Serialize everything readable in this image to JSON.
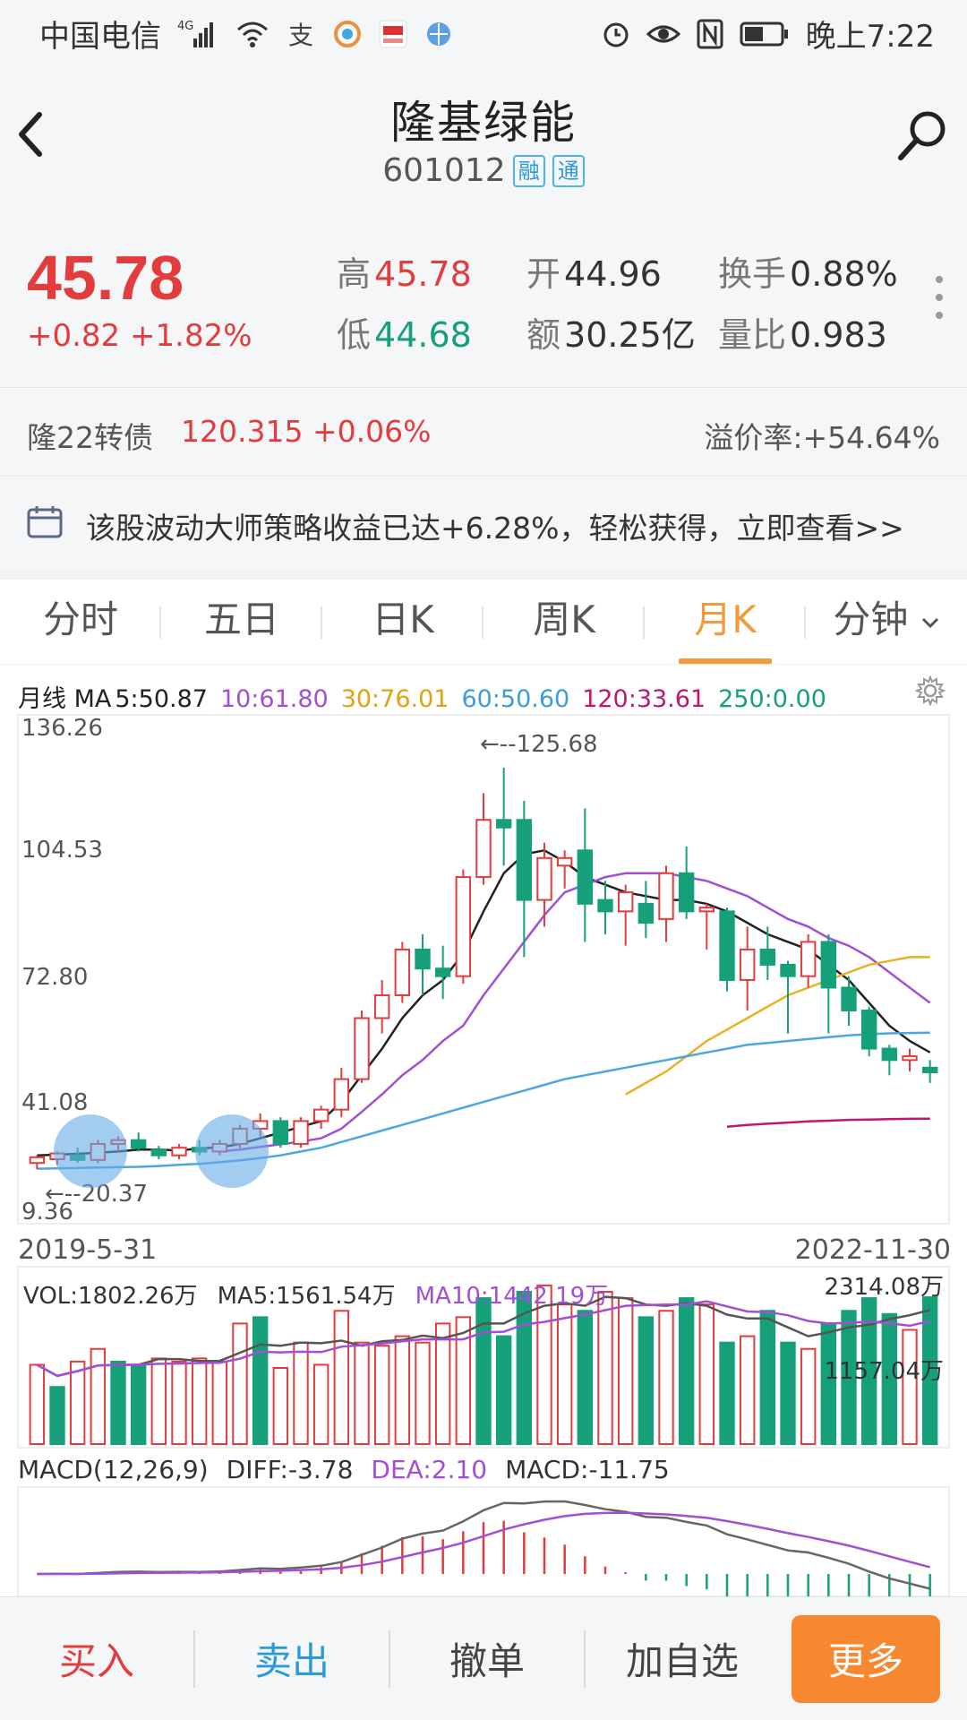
{
  "status_bar": {
    "carrier": "中国电信",
    "network": "4G",
    "time": "晚上7:22",
    "icons": [
      "signal-icon",
      "wifi-icon",
      "app-icon-1",
      "app-icon-2",
      "app-icon-3",
      "app-icon-4",
      "alarm-icon",
      "eye-icon",
      "nfc-icon",
      "battery-icon"
    ]
  },
  "header": {
    "name": "隆基绿能",
    "code": "601012",
    "tags": [
      "融",
      "通"
    ]
  },
  "quote": {
    "price": "45.78",
    "change": "+0.82",
    "change_pct": "+1.82%",
    "high_label": "高",
    "high": "45.78",
    "low_label": "低",
    "low": "44.68",
    "open_label": "开",
    "open": "44.96",
    "amount_label": "额",
    "amount": "30.25亿",
    "turnover_label": "换手",
    "turnover": "0.88%",
    "volume_ratio_label": "量比",
    "volume_ratio": "0.983"
  },
  "convertible_bond": {
    "label": "隆22转债",
    "value": "120.315 +0.06%",
    "premium": "溢价率:+54.64%"
  },
  "promo": {
    "text": "该股波动大师策略收益已达+6.28%，轻松获得，立即查看>>"
  },
  "tabs": [
    {
      "label": "分时",
      "active": false
    },
    {
      "label": "五日",
      "active": false
    },
    {
      "label": "日K",
      "active": false
    },
    {
      "label": "周K",
      "active": false
    },
    {
      "label": "月K",
      "active": true
    },
    {
      "label": "分钟",
      "active": false
    }
  ],
  "ma_legend": {
    "prefix": "月线 MA",
    "ma5": "5:50.87",
    "ma10": "10:61.80",
    "ma30": "30:76.01",
    "ma60": "60:50.60",
    "ma120": "120:33.61",
    "ma250": "250:0.00"
  },
  "colors": {
    "up": "#e23c3c",
    "down": "#16a07a",
    "ma5": "#222222",
    "ma10": "#a24fd6",
    "ma30": "#eab021",
    "ma60": "#4ea6df",
    "ma120": "#c0166f",
    "ma250": "#16a07a",
    "accent": "#f39a3a"
  },
  "chart_data": [
    {
      "type": "candlestick",
      "title": "",
      "y_ticks": [
        "136.26",
        "104.53",
        "72.80",
        "41.08",
        "9.36"
      ],
      "ylim": [
        9.36,
        136.26
      ],
      "x_start": "2019-5-31",
      "x_end": "2022-11-30",
      "max_marker": "125.68",
      "min_marker": "20.37",
      "candles": [
        {
          "o": 22,
          "h": 24,
          "l": 20.4,
          "c": 23.5,
          "up": true
        },
        {
          "o": 23,
          "h": 25,
          "l": 21.5,
          "c": 24.5,
          "up": true
        },
        {
          "o": 24,
          "h": 26,
          "l": 22,
          "c": 22.8,
          "up": false
        },
        {
          "o": 22.8,
          "h": 28,
          "l": 22,
          "c": 27,
          "up": true
        },
        {
          "o": 27,
          "h": 29,
          "l": 25,
          "c": 28,
          "up": true
        },
        {
          "o": 28,
          "h": 30,
          "l": 25,
          "c": 26,
          "up": false
        },
        {
          "o": 25.5,
          "h": 26.5,
          "l": 23,
          "c": 24,
          "up": false
        },
        {
          "o": 24,
          "h": 27,
          "l": 23,
          "c": 26,
          "up": true
        },
        {
          "o": 26,
          "h": 28,
          "l": 24,
          "c": 25,
          "up": false
        },
        {
          "o": 25,
          "h": 28,
          "l": 24,
          "c": 27,
          "up": true
        },
        {
          "o": 27,
          "h": 32,
          "l": 26,
          "c": 31,
          "up": true
        },
        {
          "o": 31,
          "h": 35,
          "l": 29,
          "c": 33,
          "up": true
        },
        {
          "o": 33,
          "h": 34,
          "l": 26,
          "c": 27,
          "up": false
        },
        {
          "o": 27,
          "h": 34,
          "l": 26,
          "c": 33,
          "up": true
        },
        {
          "o": 33,
          "h": 37,
          "l": 31,
          "c": 36,
          "up": true
        },
        {
          "o": 36,
          "h": 47,
          "l": 34,
          "c": 44,
          "up": true
        },
        {
          "o": 44,
          "h": 62,
          "l": 43,
          "c": 60,
          "up": true
        },
        {
          "o": 60,
          "h": 70,
          "l": 56,
          "c": 66,
          "up": true
        },
        {
          "o": 66,
          "h": 80,
          "l": 64,
          "c": 78,
          "up": true
        },
        {
          "o": 78,
          "h": 82,
          "l": 66,
          "c": 73,
          "up": false
        },
        {
          "o": 73,
          "h": 79,
          "l": 65,
          "c": 71,
          "up": false
        },
        {
          "o": 71,
          "h": 99,
          "l": 69,
          "c": 97,
          "up": true
        },
        {
          "o": 97,
          "h": 119,
          "l": 95,
          "c": 112,
          "up": true
        },
        {
          "o": 112,
          "h": 125.68,
          "l": 100,
          "c": 110,
          "up": false
        },
        {
          "o": 112,
          "h": 117,
          "l": 76,
          "c": 91,
          "up": false
        },
        {
          "o": 91,
          "h": 106,
          "l": 84,
          "c": 102,
          "up": true
        },
        {
          "o": 102,
          "h": 104,
          "l": 94,
          "c": 100,
          "up": true
        },
        {
          "o": 104,
          "h": 115,
          "l": 80,
          "c": 90,
          "up": false
        },
        {
          "o": 91,
          "h": 96,
          "l": 82,
          "c": 88,
          "up": false
        },
        {
          "o": 88,
          "h": 95,
          "l": 79,
          "c": 93,
          "up": true
        },
        {
          "o": 90,
          "h": 96,
          "l": 81,
          "c": 85,
          "up": false
        },
        {
          "o": 86,
          "h": 100,
          "l": 80,
          "c": 98,
          "up": true
        },
        {
          "o": 98,
          "h": 105,
          "l": 86,
          "c": 88,
          "up": false
        },
        {
          "o": 88,
          "h": 90,
          "l": 78,
          "c": 89,
          "up": true
        },
        {
          "o": 88,
          "h": 89,
          "l": 67,
          "c": 70,
          "up": false
        },
        {
          "o": 70,
          "h": 84,
          "l": 62,
          "c": 78,
          "up": true
        },
        {
          "o": 78,
          "h": 84,
          "l": 70,
          "c": 74,
          "up": false
        },
        {
          "o": 74,
          "h": 75,
          "l": 56,
          "c": 71,
          "up": false
        },
        {
          "o": 71,
          "h": 82,
          "l": 68,
          "c": 80,
          "up": true
        },
        {
          "o": 80,
          "h": 82,
          "l": 56,
          "c": 68,
          "up": false
        },
        {
          "o": 68,
          "h": 71,
          "l": 58,
          "c": 62,
          "up": false
        },
        {
          "o": 62,
          "h": 63,
          "l": 50,
          "c": 52,
          "up": false
        },
        {
          "o": 52,
          "h": 53,
          "l": 45,
          "c": 49,
          "up": false
        },
        {
          "o": 49,
          "h": 52,
          "l": 46,
          "c": 50,
          "up": true
        },
        {
          "o": 47,
          "h": 49,
          "l": 43,
          "c": 45.78,
          "up": false
        }
      ],
      "ma_series": {
        "ma5": [
          24,
          24.2,
          24.4,
          24.7,
          25,
          25.5,
          25.5,
          25.3,
          25.8,
          26.1,
          27,
          28.5,
          30,
          31.5,
          33,
          38,
          45,
          52,
          60,
          66,
          70,
          77,
          88,
          98,
          103,
          104,
          101,
          97,
          95,
          93,
          92,
          91,
          91,
          90,
          88,
          85,
          82,
          80,
          78,
          74,
          70,
          64,
          58,
          54,
          51
        ],
        "ma10": [
          null,
          null,
          null,
          null,
          null,
          null,
          null,
          null,
          null,
          25,
          25.5,
          26.2,
          26.9,
          27.6,
          28.5,
          31,
          35.4,
          40,
          45,
          49,
          54,
          58,
          66,
          73,
          80,
          87,
          93,
          95,
          97,
          98,
          98,
          98,
          97,
          96,
          94,
          92,
          89,
          86,
          84,
          81,
          79,
          76,
          72,
          68,
          64
        ],
        "ma30": [
          null,
          null,
          null,
          null,
          null,
          null,
          null,
          null,
          null,
          null,
          null,
          null,
          null,
          null,
          null,
          null,
          null,
          null,
          null,
          null,
          null,
          null,
          null,
          null,
          null,
          null,
          null,
          null,
          null,
          40,
          43,
          46,
          50,
          54,
          57,
          60,
          63,
          66,
          68,
          70,
          72,
          74,
          75,
          76,
          76.01
        ],
        "ma60": [
          20.5,
          20.6,
          20.7,
          20.8,
          20.9,
          21,
          21.2,
          21.5,
          21.8,
          22.2,
          22.7,
          23.3,
          24,
          25,
          26,
          27.5,
          29,
          30.5,
          32,
          33.5,
          35,
          36.5,
          38,
          39.5,
          41,
          42.5,
          44,
          45,
          46,
          47,
          48,
          49,
          50,
          51,
          52,
          53,
          53.5,
          54,
          54.5,
          55,
          55.5,
          55.8,
          56,
          56.1,
          56.2
        ],
        "ma120": [
          null,
          null,
          null,
          null,
          null,
          null,
          null,
          null,
          null,
          null,
          null,
          null,
          null,
          null,
          null,
          null,
          null,
          null,
          null,
          null,
          null,
          null,
          null,
          null,
          null,
          null,
          null,
          null,
          null,
          null,
          null,
          null,
          null,
          null,
          31.5,
          32,
          32.3,
          32.6,
          32.9,
          33.1,
          33.3,
          33.4,
          33.5,
          33.6,
          33.61
        ]
      }
    },
    {
      "type": "bar",
      "title": "VOL:1802.26万",
      "ma5_label": "MA5:1561.54万",
      "ma10_label": "MA10:1442.19万",
      "max_label": "2314.08万",
      "mid_label": "1157.04万",
      "unit": "万",
      "values": [
        1250,
        900,
        1300,
        1500,
        1300,
        1250,
        1350,
        1300,
        1350,
        1300,
        1900,
        2000,
        1200,
        1600,
        1250,
        2100,
        1600,
        1550,
        1700,
        1600,
        1900,
        2000,
        2300,
        1700,
        2400,
        2500,
        2200,
        2100,
        2400,
        2300,
        2000,
        2100,
        2300,
        2200,
        1600,
        1700,
        2100,
        1600,
        1500,
        1900,
        2100,
        2300,
        2050,
        1800,
        2314.08
      ],
      "up": [
        true,
        false,
        true,
        true,
        false,
        false,
        true,
        true,
        true,
        true,
        true,
        false,
        true,
        true,
        true,
        true,
        true,
        true,
        true,
        true,
        true,
        true,
        false,
        false,
        false,
        true,
        true,
        false,
        true,
        true,
        false,
        true,
        false,
        true,
        false,
        true,
        false,
        false,
        true,
        false,
        false,
        false,
        false,
        true,
        false
      ]
    },
    {
      "type": "bar",
      "title": "MACD(12,26,9)",
      "diff_label": "DIFF:-3.78",
      "dea_label": "DEA:2.10",
      "macd_label": "MACD:-11.75"
    }
  ],
  "bottom_bar": {
    "buy": "买入",
    "sell": "卖出",
    "cancel": "撤单",
    "watchlist": "加自选",
    "more": "更多"
  }
}
